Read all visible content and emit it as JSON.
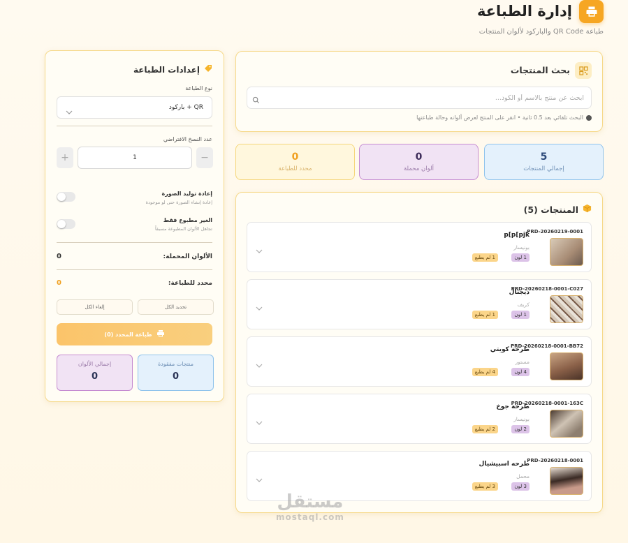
{
  "header": {
    "title": "إدارة الطباعة",
    "subtitle": "طباعة QR Code والباركود لألوان المنتجات"
  },
  "search": {
    "title": "بحث المنتجات",
    "placeholder": "ابحث عن منتج بالاسم أو الكود...",
    "hint": "البحث تلقائي بعد 0.5 ثانية • انقر على المنتج لعرض ألوانه وحالة طباعتها"
  },
  "stats": [
    {
      "value": "5",
      "label": "إجمالي المنتجات"
    },
    {
      "value": "0",
      "label": "ألوان محملة"
    },
    {
      "value": "0",
      "label": "محدد للطباعة"
    }
  ],
  "products": {
    "title": "المنتجات (5)",
    "items": [
      {
        "sku": "PRD-20260219-0001",
        "name": "p[p[pjk",
        "category": "بونيسار",
        "colors": "1 لون",
        "printed": "1 لم يطبع"
      },
      {
        "sku": "PRD-20260218-0001-C027",
        "name": "ديجتال",
        "category": "كريف",
        "colors": "1 لون",
        "printed": "1 لم يطبع"
      },
      {
        "sku": "PRD-20260218-0001-BB72",
        "name": "طرحة كويتي",
        "category": "مستور",
        "colors": "4 لون",
        "printed": "4 لم يطبع"
      },
      {
        "sku": "PRD-20260218-0001-163C",
        "name": "طرحة جوخ",
        "category": "بونيسار",
        "colors": "2 لون",
        "printed": "2 لم يطبع"
      },
      {
        "sku": "PRD-20260218-0001",
        "name": "طرحه اسبيشيال",
        "category": "محمل",
        "colors": "3 لون",
        "printed": "3 لم يطبع"
      }
    ]
  },
  "settings": {
    "title": "إعدادات الطباعة",
    "print_type_label": "نوع الطباعة",
    "print_type_value": "QR + باركود",
    "copies_label": "عدد النسخ الافتراضي",
    "copies_value": "1",
    "regen_title": "إعادة توليد الصورة",
    "regen_sub": "إعادة إنشاء الصورة حتى لو موجودة",
    "unprinted_title": "الغير مطبوع فقط",
    "unprinted_sub": "تجاهل الألوان المطبوعة مسبقاً",
    "loaded_label": "الألوان المحملة:",
    "loaded_value": "0",
    "selected_label": "محدد للطباعة:",
    "selected_value": "0",
    "select_all": "تحديد الكل",
    "deselect_all": "إلغاء الكل",
    "print_button": "طباعة المحدد (0)",
    "missing_label": "منتجات مفقودة",
    "missing_value": "0",
    "total_colors_label": "إجمالي الألوان",
    "total_colors_value": "0"
  },
  "watermark": {
    "ar": "مستقل",
    "en": "mostaql.com"
  },
  "colors": {
    "accent": "#f6a623",
    "blue": "#8fc3ec",
    "purple": "#c58bd1",
    "yellow": "#f5d67a"
  }
}
